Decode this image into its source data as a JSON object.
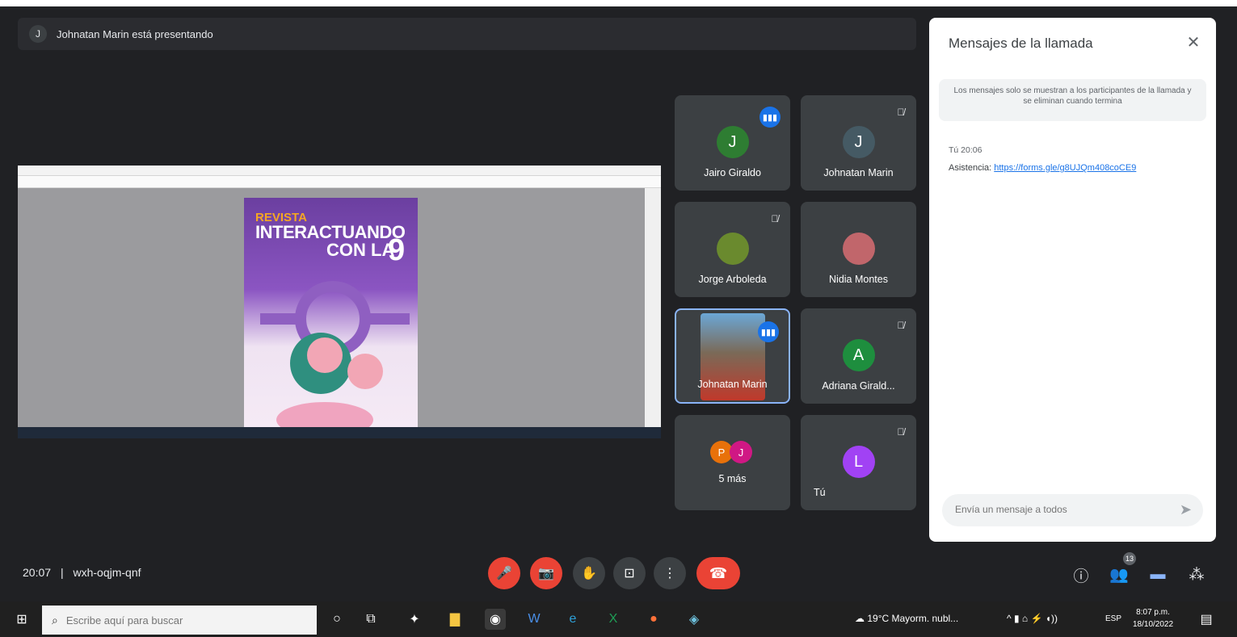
{
  "presenter_banner": {
    "avatar_initial": "J",
    "text": "Johnatan Marin está presentando"
  },
  "shared_screen": {
    "magazine": {
      "revista": "REVISTA",
      "line1": "INTERACTUANDO",
      "line2": "CON LA",
      "number": "9"
    }
  },
  "participants": [
    {
      "name": "Jairo Giraldo",
      "initial": "J",
      "color": "#2e7d32",
      "state": "speaking"
    },
    {
      "name": "Johnatan Marin",
      "initial": "J",
      "color": "#455a64",
      "state": "muted"
    },
    {
      "name": "Jorge Arboleda",
      "initial": "",
      "color": "#6a8a2e",
      "state": "muted"
    },
    {
      "name": "Nidia Montes",
      "initial": "",
      "color": "#c1666b",
      "state": "none"
    },
    {
      "name": "Johnatan Marin",
      "initial": "",
      "color": "#c0392b",
      "state": "speaking",
      "video": true
    },
    {
      "name": "Adriana Girald...",
      "initial": "A",
      "color": "#1e8e3e",
      "state": "muted"
    },
    {
      "name": "5 más",
      "initial": "",
      "color": "",
      "state": "none",
      "stack": [
        "P",
        "J"
      ]
    },
    {
      "name": "Tú",
      "initial": "L",
      "color": "#a142f4",
      "state": "muted"
    }
  ],
  "chat": {
    "title": "Mensajes de la llamada",
    "note": "Los mensajes solo se muestran a los participantes de la llamada y se eliminan cuando termina",
    "sender": "Tú  20:06",
    "message_prefix": "Asistencia: ",
    "message_link": "https://forms.gle/g8UJQm408coCE9",
    "input_placeholder": "Envía un mensaje a todos"
  },
  "bottom_bar": {
    "time": "20:07",
    "separator": "|",
    "meeting_code": "wxh-oqjm-qnf",
    "participant_count": "13"
  },
  "taskbar": {
    "search_placeholder": "Escribe aquí para buscar",
    "weather": "19°C  Mayorm. nubl...",
    "lang": "ESP",
    "time": "8:07 p.m.",
    "date": "18/10/2022"
  },
  "colors": {
    "bg": "#202124",
    "tile": "#3c4043",
    "end_call": "#ea4335",
    "accent": "#1a73e8"
  }
}
